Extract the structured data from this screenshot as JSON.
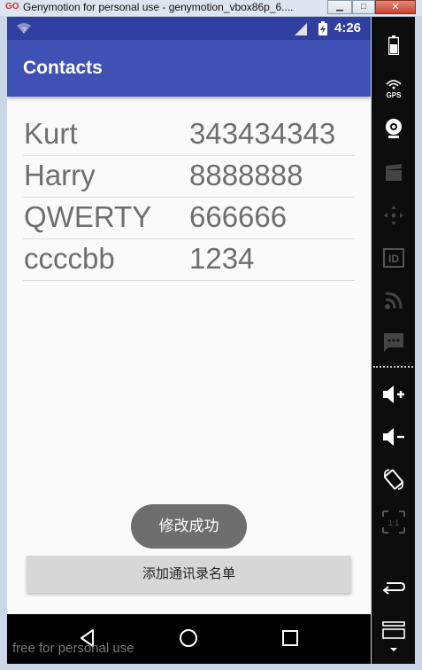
{
  "window": {
    "title": "Genymotion for personal use - genymotion_vbox86p_6....",
    "app_icon_text": "GO"
  },
  "status_bar": {
    "time": "4:26",
    "wifi_badge": "?"
  },
  "app_bar": {
    "title": "Contacts"
  },
  "contacts": [
    {
      "name": "Kurt",
      "phone": "343434343"
    },
    {
      "name": "Harry",
      "phone": "8888888"
    },
    {
      "name": "QWERTY",
      "phone": "666666"
    },
    {
      "name": "ccccbb",
      "phone": "1234"
    }
  ],
  "toast": {
    "text": "修改成功"
  },
  "add_button": {
    "label": "添加通讯录名单"
  },
  "watermark": "free for personal use",
  "toolbar": {
    "gps_label": "GPS",
    "id_label": "ID",
    "pixel_label": "1:1"
  },
  "colors": {
    "status_bar": "#303f9f",
    "app_bar": "#3f51b5",
    "toast": "#6e6e6e",
    "button": "#d7d7d7"
  }
}
